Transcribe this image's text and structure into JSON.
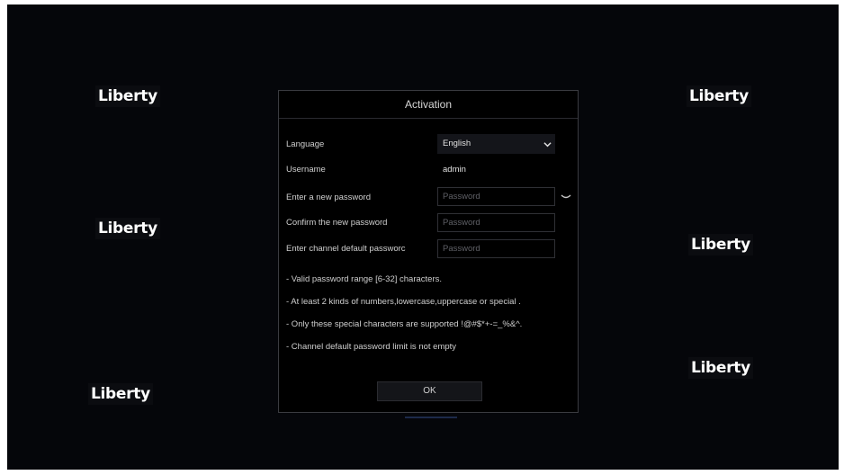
{
  "brand": {
    "logo_text": "Liberty"
  },
  "dialog": {
    "title": "Activation",
    "language_label": "Language",
    "language_value": "English",
    "username_label": "Username",
    "username_value": "admin",
    "new_password_label": "Enter a new password",
    "new_password_placeholder": "Password",
    "confirm_password_label": "Confirm the new password",
    "confirm_password_placeholder": "Password",
    "channel_password_label": "Enter channel default passworc",
    "channel_password_placeholder": "Password",
    "hints": [
      "- Valid password range [6-32] characters.",
      "- At least 2 kinds of numbers,lowercase,uppercase or special .",
      "- Only these special characters are supported !@#$*+-=_%&^.",
      "- Channel default password limit is not empty"
    ],
    "ok_label": "OK"
  },
  "colors": {
    "background": "#05060a",
    "dialog_border": "#3a3b40",
    "text": "#cfcfcf"
  },
  "icons": {
    "language_dropdown": "chevron-down-icon",
    "password_visibility": "eye-closed-icon"
  }
}
